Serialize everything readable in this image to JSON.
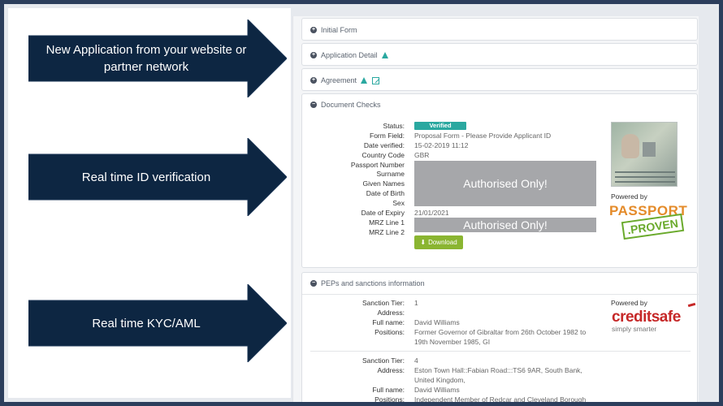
{
  "callouts": [
    {
      "text": "New Application from your website or partner network"
    },
    {
      "text": "Real time ID verification"
    },
    {
      "text": "Real time KYC/AML"
    }
  ],
  "colors": {
    "callout_bg": "#0d2642",
    "accent": "#2aa8a0",
    "download_btn": "#8ab531"
  },
  "sections": {
    "initial_form": "Initial Form",
    "application_detail": "Application Detail",
    "agreement": "Agreement",
    "document_checks": "Document Checks",
    "peps": "PEPs and sanctions information"
  },
  "doc_checks": {
    "status_label": "Status:",
    "status_value": "Verified",
    "form_field_label": "Form Field:",
    "form_field_value": "Proposal Form - Please Provide Applicant ID",
    "date_verified_label": "Date verified:",
    "date_verified_value": "15-02-2019 11:12",
    "country_code_label": "Country Code",
    "country_code_value": "GBR",
    "passport_number_label": "Passport Number",
    "surname_label": "Surname",
    "given_names_label": "Given Names",
    "dob_label": "Date of Birth",
    "sex_label": "Sex",
    "expiry_label": "Date of Expiry",
    "expiry_value": "21/01/2021",
    "mrz1_label": "MRZ Line 1",
    "mrz2_label": "MRZ Line 2",
    "redacted_1": "Authorised Only!",
    "redacted_2": "Authorised Only!",
    "download": "Download",
    "powered_by": "Powered by",
    "logo_line1": "PASSPORT",
    "logo_line2": ".PROVEN"
  },
  "peps": {
    "powered_by": "Powered by",
    "logo_main": "creditsafe",
    "logo_tag": "simply smarter",
    "entries": [
      {
        "tier_label": "Sanction Tier:",
        "tier": "1",
        "address_label": "Address:",
        "address": "",
        "fullname_label": "Full name:",
        "fullname": "David Williams",
        "positions_label": "Positions:",
        "positions_1": "Former Governor of Gibraltar from 26th October 1982 to",
        "positions_2": "19th November 1985, GI"
      },
      {
        "tier_label": "Sanction Tier:",
        "tier": "4",
        "address_label": "Address:",
        "address_1": "Eston Town Hall::Fabian Road:::TS6 9AR, South Bank,",
        "address_2": "United Kingdom,",
        "fullname_label": "Full name:",
        "fullname": "David Williams",
        "positions_label": "Positions:",
        "positions_1": "Independent Member of Redcar and Cleveland Borough"
      }
    ]
  }
}
